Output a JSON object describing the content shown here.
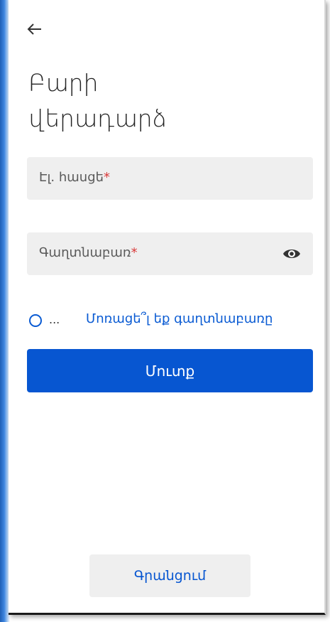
{
  "header": {
    "back_icon": "arrow-left-icon",
    "title_line1": "Բարի",
    "title_line2": "վերադարձ"
  },
  "form": {
    "email_placeholder": "Էլ. հասցե",
    "password_placeholder": "Գաղտնաբառ",
    "required_mark": "*",
    "password_toggle_icon": "eye-icon",
    "remember_label": "...",
    "forgot_password": "Մոռացե՞լ եք գաղտնաբառը",
    "login_button": "Մուտք"
  },
  "footer": {
    "register_button": "Գրանցում"
  },
  "colors": {
    "accent": "#0756d1",
    "field_bg": "#efefef",
    "required": "#d93a3a"
  }
}
